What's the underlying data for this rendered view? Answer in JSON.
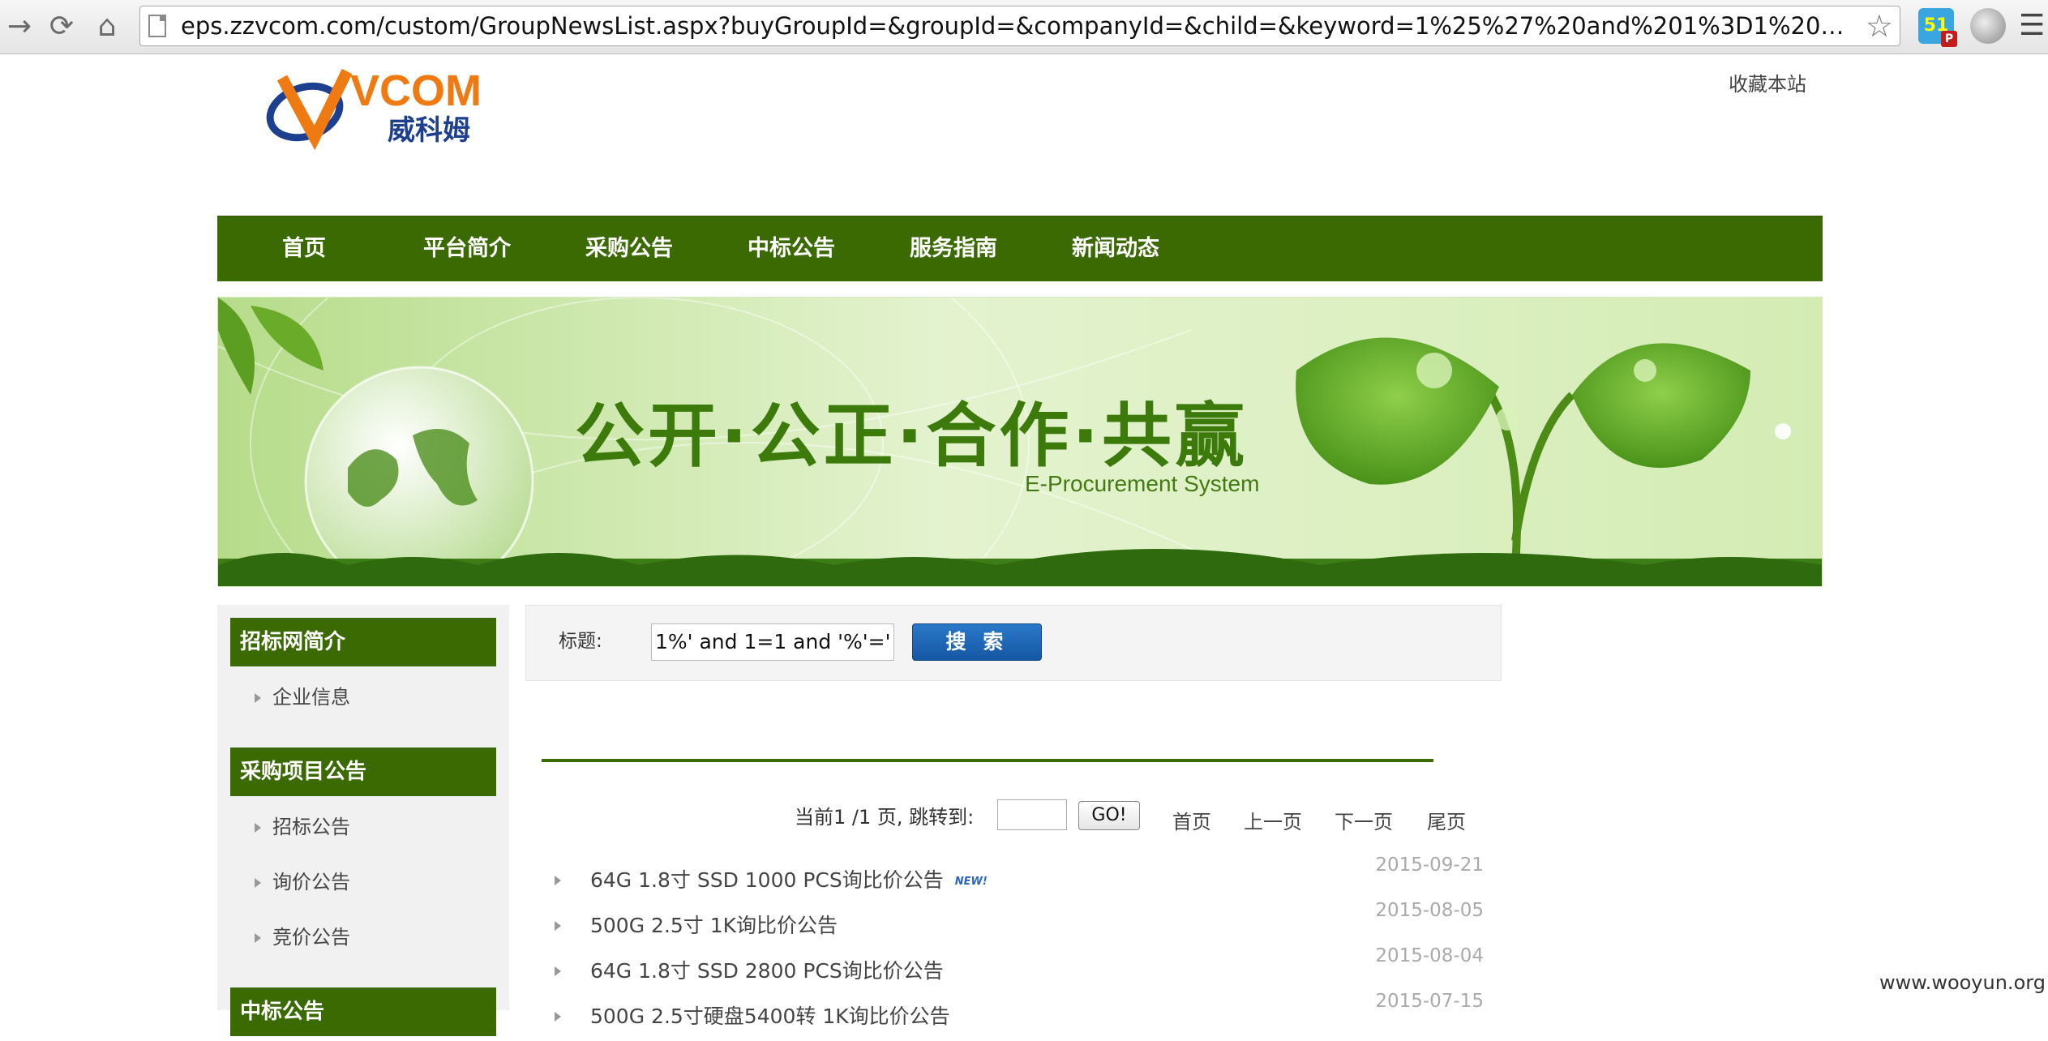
{
  "browser": {
    "url": "eps.zzvcom.com/custom/GroupNewsList.aspx?buyGroupId=&groupId=&companyId=&child=&keyword=1%25%27%20and%201%3D1%20and%20%27%...",
    "ext_badge": "51",
    "ext_badge_sub": "P"
  },
  "header": {
    "logo_text": "VCOM",
    "logo_cn": "威科姆",
    "favorite_link": "收藏本站"
  },
  "nav": {
    "items": [
      "首页",
      "平台简介",
      "采购公告",
      "中标公告",
      "服务指南",
      "新闻动态"
    ]
  },
  "banner": {
    "slogan": "公开·公正·合作·共赢",
    "subtitle": "E-Procurement System"
  },
  "sidebar": {
    "sections": [
      {
        "title": "招标网简介",
        "items": [
          "企业信息"
        ]
      },
      {
        "title": "采购项目公告",
        "items": [
          "招标公告",
          "询价公告",
          "竞价公告"
        ]
      },
      {
        "title": "中标公告",
        "items": []
      }
    ]
  },
  "search": {
    "label": "标题:",
    "value": "1%' and 1=1 and '%'='",
    "button": "搜 索"
  },
  "pager": {
    "text": "当前1 /1 页, 跳转到:",
    "go": "GO!",
    "first": "首页",
    "prev": "上一页",
    "next": "下一页",
    "last": "尾页"
  },
  "news": [
    {
      "title": "64G 1.8寸 SSD 1000 PCS询比价公告",
      "date": "2015-09-21",
      "badge": "NEW!"
    },
    {
      "title": "500G 2.5寸 1K询比价公告",
      "date": "2015-08-05"
    },
    {
      "title": "64G 1.8寸 SSD 2800 PCS询比价公告",
      "date": "2015-08-04"
    },
    {
      "title": "500G 2.5寸硬盘5400转 1K询比价公告",
      "date": "2015-07-15"
    }
  ],
  "watermark": "www.wooyun.org",
  "colors": {
    "nav_green": "#3b6a03",
    "search_blue": "#1f6bbd"
  }
}
